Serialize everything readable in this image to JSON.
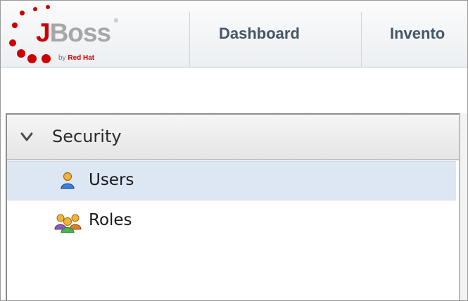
{
  "header": {
    "logo": {
      "brand_j": "J",
      "brand_rest": "Boss",
      "registered": "®",
      "by": "by",
      "redhat": "Red Hat"
    },
    "nav": [
      {
        "label": "Dashboard",
        "icon": "none"
      },
      {
        "label": "Invento",
        "icon": "none"
      }
    ]
  },
  "tree": {
    "section_title": "Security",
    "expanded": true,
    "items": [
      {
        "label": "Users",
        "icon": "user-icon",
        "selected": true
      },
      {
        "label": "Roles",
        "icon": "group-icon",
        "selected": false
      }
    ]
  },
  "colors": {
    "brand_red": "#cc0000",
    "nav_text": "#465566",
    "selection": "#dde6f3"
  }
}
